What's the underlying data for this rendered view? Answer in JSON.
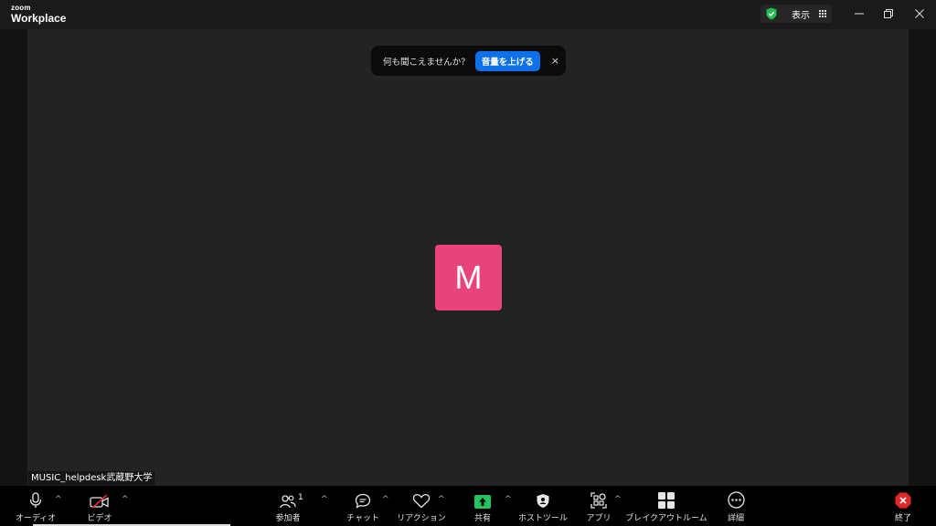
{
  "app": {
    "brand_top": "zoom",
    "brand_bottom": "Workplace"
  },
  "titlebar": {
    "view_label": "表示",
    "icons": [
      "shield-check-icon",
      "grid-icon",
      "minimize-icon",
      "restore-icon",
      "close-icon"
    ]
  },
  "toast": {
    "message": "何も聞こえませんか？",
    "button": "音量を上げる",
    "close": "×"
  },
  "participant": {
    "initial": "M",
    "name": "MUSIC_helpdesk武蔵野大学",
    "avatar_color": "#e9437b"
  },
  "toolbar": {
    "audio": "オーディオ",
    "video": "ビデオ",
    "participants": "参加者",
    "participants_count": "1",
    "chat": "チャット",
    "reactions": "リアクション",
    "share": "共有",
    "host_tools": "ホストツール",
    "apps": "アプリ",
    "breakout": "ブレイクアウトルーム",
    "more": "詳細",
    "end": "終了",
    "caret": "^"
  },
  "colors": {
    "accent_blue": "#0e71eb",
    "share_green": "#22c55e",
    "end_red": "#e02828"
  }
}
